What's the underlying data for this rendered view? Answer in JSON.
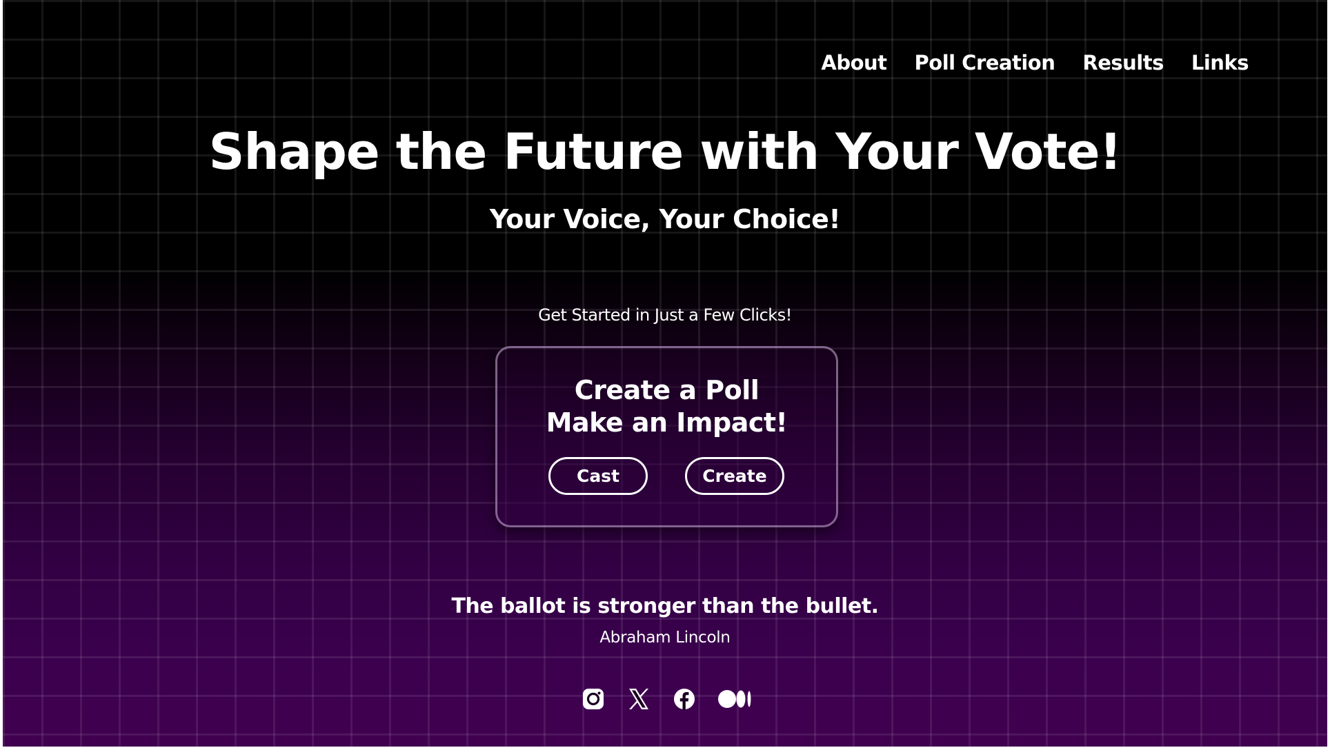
{
  "nav": {
    "items": [
      {
        "label": "About"
      },
      {
        "label": "Poll Creation"
      },
      {
        "label": "Results"
      },
      {
        "label": "Links"
      }
    ]
  },
  "hero": {
    "title": "Shape the Future with Your Vote!",
    "subtitle": "Your Voice, Your Choice!"
  },
  "cta": {
    "lead": "Get Started in Just a Few Clicks!",
    "card_line1": "Create a Poll",
    "card_line2": "Make an Impact!",
    "cast_label": "Cast",
    "create_label": "Create"
  },
  "quote": {
    "text": "The ballot is stronger than the bullet.",
    "author": "Abraham Lincoln"
  },
  "social": [
    {
      "icon": "instagram-icon"
    },
    {
      "icon": "x-icon"
    },
    {
      "icon": "facebook-icon"
    },
    {
      "icon": "medium-icon"
    }
  ],
  "colors": {
    "background_top": "#000000",
    "background_bottom": "#40004f",
    "text": "#ffffff",
    "card_border": "#bea5cd"
  }
}
